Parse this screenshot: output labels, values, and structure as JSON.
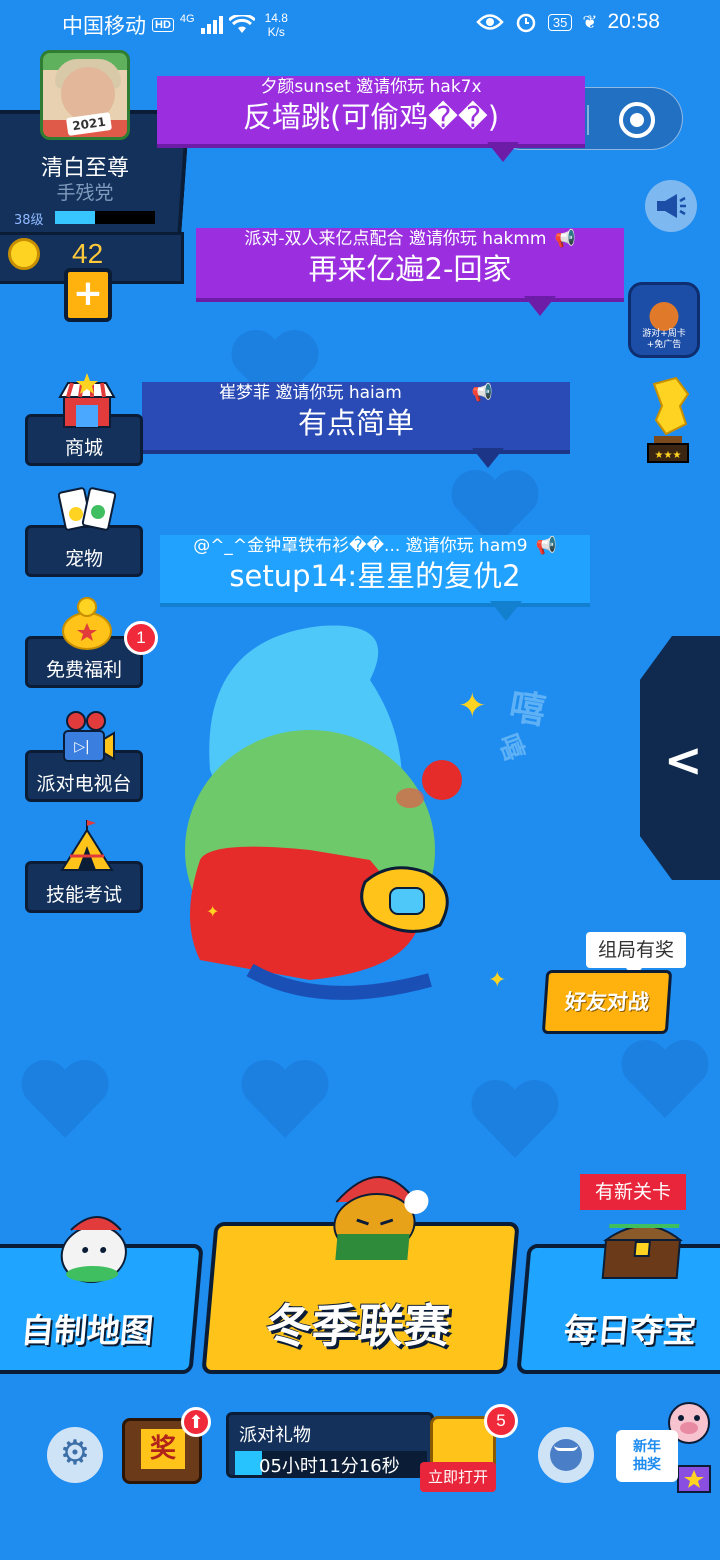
{
  "statusbar": {
    "carrier": "中国移动",
    "hd": "HD",
    "network": "4G",
    "speed_value": "14.8",
    "speed_unit": "K/s",
    "battery": "35",
    "time": "20:58"
  },
  "profile": {
    "name": "清白至尊",
    "title": "手残党",
    "level": "38级",
    "level_progress": 0.4,
    "avatar_year": "2021",
    "coins": "42"
  },
  "invites": [
    {
      "inviter": "夕颜sunset 邀请你玩 hak7x",
      "map": "反墙跳(可偷鸡��)"
    },
    {
      "inviter": "派对-双人来亿点配合 邀请你玩 hakmm",
      "map": "再来亿遍2-回家"
    },
    {
      "inviter": "崔梦菲 邀请你玩 haiam",
      "map": "有点简单"
    },
    {
      "inviter": "@^_^金钟罩铁布衫��... 邀请你玩 ham9",
      "map": "setup14:星星的复仇2"
    }
  ],
  "left_menu": [
    {
      "label": "商城",
      "icon": "shop-icon"
    },
    {
      "label": "宠物",
      "icon": "pet-cards-icon"
    },
    {
      "label": "免费福利",
      "icon": "piggy-bank-icon",
      "badge": "1"
    },
    {
      "label": "派对电视台",
      "icon": "camera-icon"
    },
    {
      "label": "技能考试",
      "icon": "tent-icon"
    }
  ],
  "right_side": {
    "ad_card_label": "游对+周卡\n+免广告"
  },
  "decor": {
    "xixi": "嘻",
    "xixi2": "嘻"
  },
  "friend_battle": {
    "tip": "组局有奖",
    "label": "好友对战"
  },
  "big_buttons": {
    "custom_map": "自制地图",
    "winter_league": "冬季联赛",
    "daily_treasure": "每日夺宝",
    "new_level_tag": "有新关卡"
  },
  "bottom_bar": {
    "prize_label": "奖",
    "gift_title": "派对礼物",
    "gift_timer": "05小时11分16秒",
    "gift_progress": 0.14,
    "chest_badge": "5",
    "open_now": "立即打开",
    "new_year_lottery": "新年\n抽奖"
  },
  "colors": {
    "background": "#1f8cf0",
    "panel": "#13315a",
    "accent_yellow": "#ffc31a",
    "invite_purple": "#9b2fe0",
    "badge_red": "#f02a3a"
  }
}
